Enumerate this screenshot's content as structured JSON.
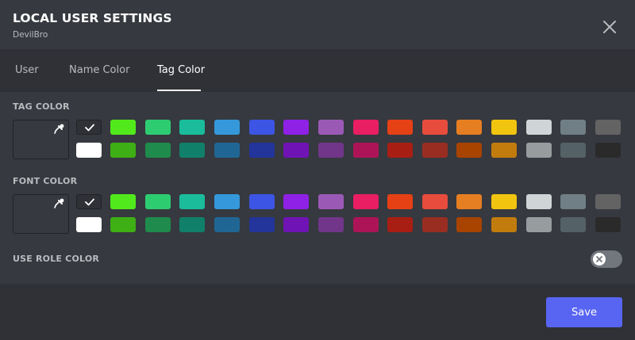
{
  "modal": {
    "title": "LOCAL USER SETTINGS",
    "subtitle": "DevilBro"
  },
  "tabs": [
    {
      "label": "User",
      "active": false
    },
    {
      "label": "Name Color",
      "active": false
    },
    {
      "label": "Tag Color",
      "active": true
    }
  ],
  "tag_color": {
    "label": "TAG COLOR",
    "selected": "none"
  },
  "font_color": {
    "label": "FONT COLOR",
    "selected": "none"
  },
  "palette": {
    "row1": [
      "none",
      "#52e91c",
      "#2ecc71",
      "#1abc9c",
      "#3498db",
      "#3c55e5",
      "#8f21e6",
      "#9b59b6",
      "#e91e63",
      "#e64115",
      "#e74c3c",
      "#e67e22",
      "#f1c40f",
      "#cfd4d6",
      "#707f86",
      "#636363"
    ],
    "row2": [
      "#ffffff",
      "#3eaf14",
      "#1f8b4c",
      "#11806a",
      "#206694",
      "#23349a",
      "#7013b4",
      "#71368a",
      "#ad1457",
      "#a91e13",
      "#992d22",
      "#a84300",
      "#c27c0e",
      "#979c9f",
      "#546167",
      "#2a2a2a"
    ]
  },
  "use_role_color": {
    "label": "USE ROLE COLOR",
    "enabled": false
  },
  "footer": {
    "save_label": "Save"
  },
  "colors": {
    "accent": "#5865f2",
    "background": "#36393f",
    "bar": "#2f3136"
  },
  "icons": {
    "close": "close-icon",
    "dropper": "eyedropper-icon",
    "check": "check-icon",
    "toggle_off": "x-icon"
  }
}
